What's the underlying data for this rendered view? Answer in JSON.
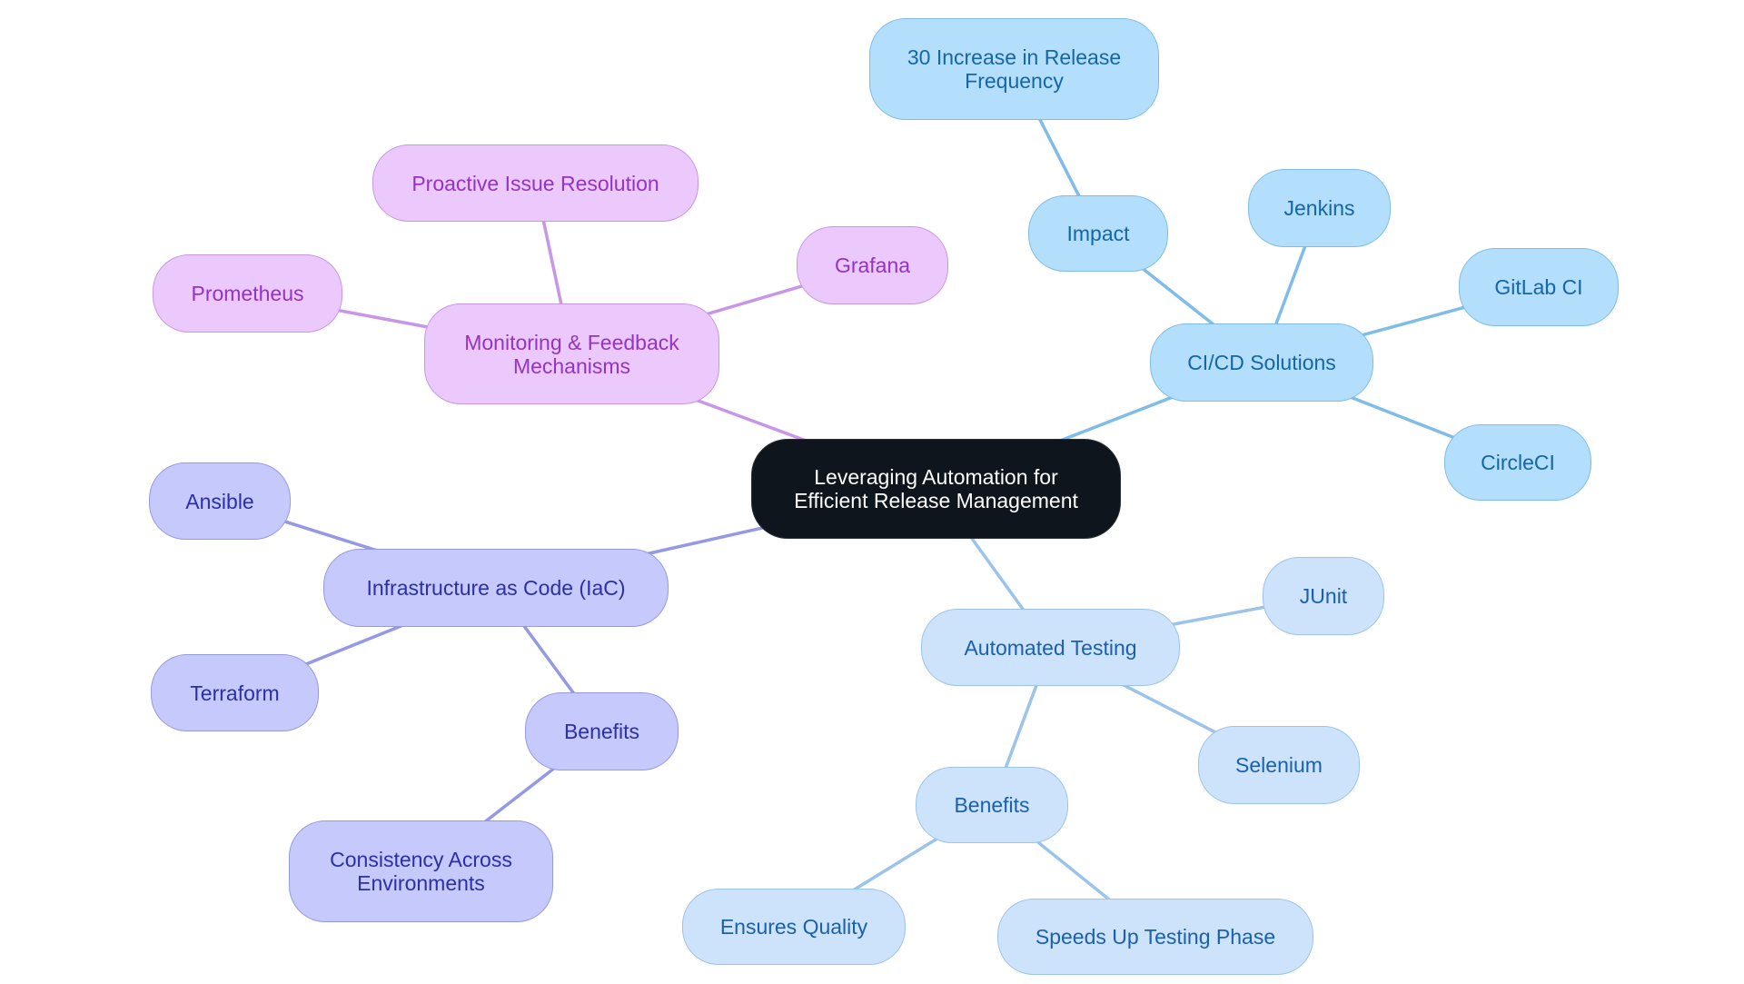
{
  "diagram": {
    "type": "mind-map",
    "root": {
      "id": "root",
      "label": "Leveraging Automation for\nEfficient Release Management"
    },
    "branches": [
      {
        "id": "cicd",
        "label": "CI/CD Solutions",
        "color": "#7fbde8",
        "children": [
          {
            "id": "impact",
            "label": "Impact",
            "children": [
              {
                "id": "increase",
                "label": "30 Increase in Release\nFrequency"
              }
            ]
          },
          {
            "id": "jenkins",
            "label": "Jenkins"
          },
          {
            "id": "gitlab",
            "label": "GitLab CI"
          },
          {
            "id": "circleci",
            "label": "CircleCI"
          }
        ]
      },
      {
        "id": "testing",
        "label": "Automated Testing",
        "color": "#9cc3ea",
        "children": [
          {
            "id": "junit",
            "label": "JUnit"
          },
          {
            "id": "selenium",
            "label": "Selenium"
          },
          {
            "id": "test-benefits",
            "label": "Benefits",
            "children": [
              {
                "id": "quality",
                "label": "Ensures Quality"
              },
              {
                "id": "speed",
                "label": "Speeds Up Testing Phase"
              }
            ]
          }
        ]
      },
      {
        "id": "iac",
        "label": "Infrastructure as Code (IaC)",
        "color": "#9599e3",
        "children": [
          {
            "id": "ansible",
            "label": "Ansible"
          },
          {
            "id": "terraform",
            "label": "Terraform"
          },
          {
            "id": "iac-benefits",
            "label": "Benefits",
            "children": [
              {
                "id": "consistency",
                "label": "Consistency Across\nEnvironments"
              }
            ]
          }
        ]
      },
      {
        "id": "monitoring",
        "label": "Monitoring & Feedback\nMechanisms",
        "color": "#c896e8",
        "children": [
          {
            "id": "proactive",
            "label": "Proactive Issue Resolution"
          },
          {
            "id": "prometheus",
            "label": "Prometheus"
          },
          {
            "id": "grafana",
            "label": "Grafana"
          }
        ]
      }
    ]
  },
  "labels": {
    "root": "Leveraging Automation for\nEfficient Release Management",
    "cicd": "CI/CD Solutions",
    "impact": "Impact",
    "increase": "30 Increase in Release\nFrequency",
    "jenkins": "Jenkins",
    "gitlab": "GitLab CI",
    "circleci": "CircleCI",
    "testing": "Automated Testing",
    "junit": "JUnit",
    "selenium": "Selenium",
    "test_benefits": "Benefits",
    "quality": "Ensures Quality",
    "speed": "Speeds Up Testing Phase",
    "iac": "Infrastructure as Code (IaC)",
    "ansible": "Ansible",
    "terraform": "Terraform",
    "iac_benefits": "Benefits",
    "consistency": "Consistency Across\nEnvironments",
    "monitoring": "Monitoring & Feedback\nMechanisms",
    "proactive": "Proactive Issue Resolution",
    "prometheus": "Prometheus",
    "grafana": "Grafana"
  },
  "colors": {
    "root_fill": "#0e151c",
    "cicd_fill": "#b3defc",
    "testing_fill": "#cde3fb",
    "iac_fill": "#c6c9fb",
    "monitoring_fill": "#ebc9fc"
  }
}
